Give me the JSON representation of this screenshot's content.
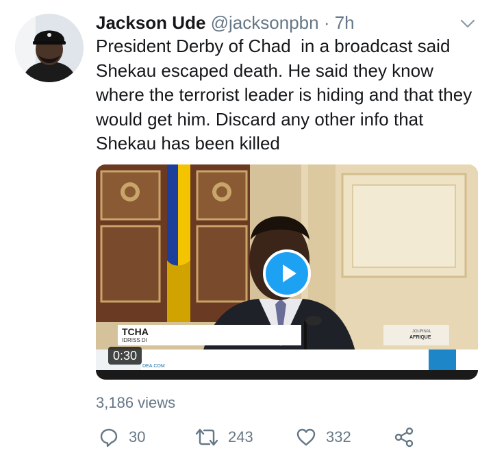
{
  "tweet": {
    "author_name": "Jackson Ude",
    "handle": "@jacksonpbn",
    "separator": "·",
    "time": "7h",
    "text": "President Derby of Chad  in a broadcast said Shekau escaped death. He said they know where the terrorist leader is hiding and that they would get him. Discard any other info that Shekau has been killed"
  },
  "video": {
    "duration": "0:30",
    "lower_third_title": "TCHA",
    "lower_third_sub": "IDRISS DI",
    "ticker": "DEA.COM",
    "logo_line1": "JOURNAL",
    "logo_line2": "AFRIQUE"
  },
  "stats": {
    "views": "3,186 views"
  },
  "actions": {
    "replies": "30",
    "retweets": "243",
    "likes": "332"
  },
  "icons": {
    "chevron": "chevron-down-icon",
    "play": "play-icon",
    "reply": "reply-icon",
    "retweet": "retweet-icon",
    "like": "heart-icon",
    "share": "share-icon"
  },
  "colors": {
    "accent": "#1da1f2",
    "secondary_text": "#657786",
    "primary_text": "#14171a"
  }
}
